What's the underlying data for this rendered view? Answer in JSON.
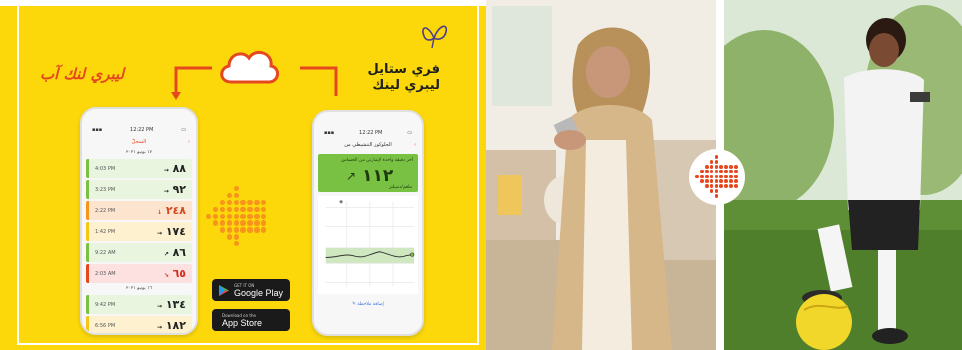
{
  "colors": {
    "yellow": "#fcd80b",
    "orange": "#e5481f",
    "dots": "#f7941d",
    "green": "#79c142"
  },
  "left_title": "ليبري لنك آب",
  "right_title_line1": "فري ستايل",
  "right_title_line2": "ليبري لينك",
  "phone_left": {
    "time": "12:22 PM",
    "header": "السجلّ",
    "date1": "١٧ يونيو ٢٠٢١",
    "rows": [
      {
        "value": "٨٨",
        "arrow": "→",
        "time": "4:03 PM",
        "color": "#e9f5de",
        "bar": "#79c142"
      },
      {
        "value": "٩٢",
        "arrow": "→",
        "time": "3:23 PM",
        "color": "#e9f5de",
        "bar": "#79c142"
      },
      {
        "value": "٢٤٨",
        "arrow": "↓",
        "time": "2:22 PM",
        "color": "#fde4cf",
        "bar": "#f7941d"
      },
      {
        "value": "١٧٤",
        "arrow": "→",
        "time": "1:42 PM",
        "color": "#fdf1d0",
        "bar": "#f5c518"
      },
      {
        "value": "٨٦",
        "arrow": "↗",
        "time": "9:22 AM",
        "color": "#e9f5de",
        "bar": "#79c142"
      },
      {
        "value": "٦٥",
        "arrow": "↘",
        "time": "2:03 AM",
        "color": "#fde0e0",
        "bar": "#e5481f"
      }
    ],
    "date2": "١٦ يونيو ٢٠٢١",
    "rows2": [
      {
        "value": "١٣٤",
        "arrow": "→",
        "time": "9:42 PM",
        "color": "#e9f5de",
        "bar": "#79c142"
      },
      {
        "value": "١٨٢",
        "arrow": "→",
        "time": "6:56 PM",
        "color": "#fdf1d0",
        "bar": "#f5c518"
      }
    ]
  },
  "phone_right": {
    "time": "12:22 PM",
    "header": "الجلوكوز التنشيطي من",
    "card_text": "أخر دقيقة واحدة لإشارتي من الحساس",
    "value": "١١٢",
    "unit": "ملغم/دسيلتر",
    "footer_link": "إضافة ملاحظة"
  },
  "badges": {
    "google_small": "GET IT ON",
    "google_big": "Google Play",
    "apple_small": "Download on the",
    "apple_big": "App Store"
  }
}
